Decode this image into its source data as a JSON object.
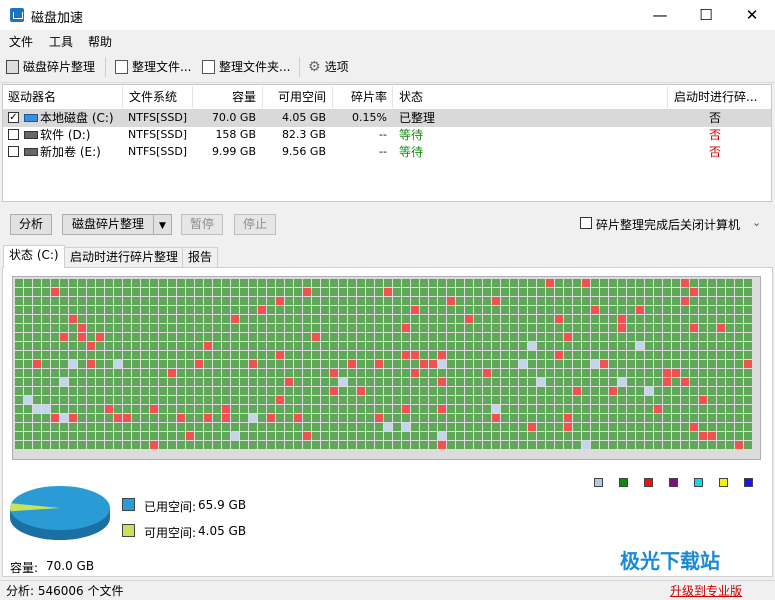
{
  "window": {
    "title": "磁盘加速",
    "minimize": "—",
    "maximize": "☐",
    "close": "✕"
  },
  "menu": [
    "文件",
    "工具",
    "帮助"
  ],
  "toolbar": {
    "defrag": "磁盘碎片整理",
    "defrag_files": "整理文件...",
    "defrag_folder": "整理文件夹...",
    "options": "选项"
  },
  "drive_table": {
    "columns": [
      "驱动器名",
      "文件系统",
      "容量",
      "可用空间",
      "碎片率",
      "状态",
      "启动时进行碎..."
    ],
    "rows": [
      {
        "checked": true,
        "name": "本地磁盘 (C:)",
        "fs": "NTFS[SSD]",
        "capacity": "70.0 GB",
        "free": "4.05 GB",
        "frag": "0.15%",
        "status": "已整理",
        "boot": "否"
      },
      {
        "checked": false,
        "name": "软件 (D:)",
        "fs": "NTFS[SSD]",
        "capacity": "158 GB",
        "free": "82.3 GB",
        "frag": "--",
        "status": "等待",
        "boot": "否"
      },
      {
        "checked": false,
        "name": "新加卷 (E:)",
        "fs": "NTFS[SSD]",
        "capacity": "9.99 GB",
        "free": "9.56 GB",
        "frag": "--",
        "status": "等待",
        "boot": "否"
      }
    ]
  },
  "actions": {
    "analyze": "分析",
    "defrag": "磁盘碎片整理",
    "pause": "暂停",
    "stop": "停止",
    "shutdown_option": "碎片整理完成后关闭计算机",
    "shutdown_checked": false
  },
  "tabs": [
    "状态 (C:)",
    "启动时进行碎片整理",
    "报告"
  ],
  "legend_colors": [
    "#b4c8e4",
    "#0b8a0b",
    "#ee1111",
    "#7f0f7f",
    "#11d6e6",
    "#f0f011",
    "#1a1ae0"
  ],
  "colors": {
    "map_green": "#5fa85a",
    "map_red": "#f05252",
    "map_free": "#c5d5ec",
    "pie_used": "#2b9bd6",
    "pie_free": "#c9e25e"
  },
  "disk_usage": {
    "used_label": "已用空间:",
    "used_value": "65.9 GB",
    "free_label": "可用空间:",
    "free_value": "4.05 GB",
    "capacity_label": "容量:",
    "capacity_value": "70.0 GB",
    "used_gb": 65.9,
    "free_gb": 4.05
  },
  "status": {
    "text": "分析: 546006 个文件",
    "upgrade": "升级到专业版"
  },
  "watermark": "极光下载站"
}
